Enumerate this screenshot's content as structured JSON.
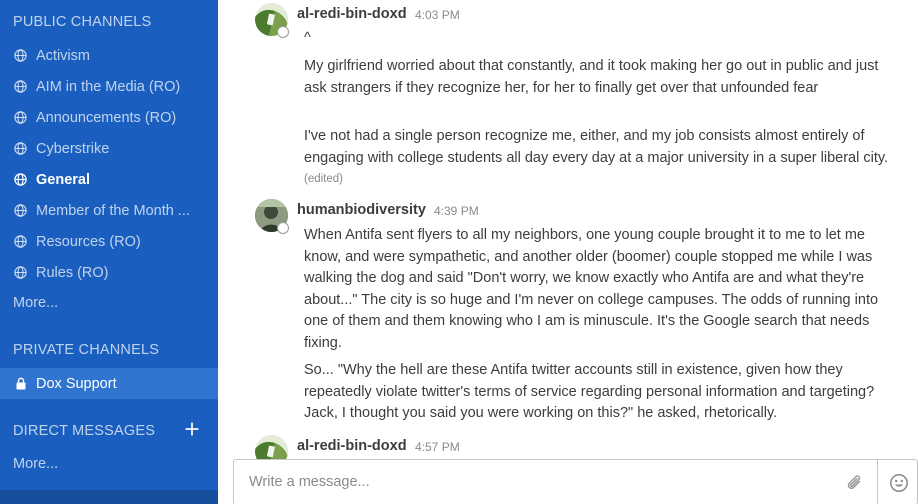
{
  "sidebar": {
    "public_header": "PUBLIC CHANNELS",
    "public_channels": [
      {
        "label": "Activism",
        "icon": "globe-icon"
      },
      {
        "label": "AIM in the Media (RO)",
        "icon": "globe-icon"
      },
      {
        "label": "Announcements (RO)",
        "icon": "globe-icon"
      },
      {
        "label": "Cyberstrike",
        "icon": "globe-icon"
      },
      {
        "label": "General",
        "icon": "globe-icon"
      },
      {
        "label": "Member of the Month ...",
        "icon": "globe-icon"
      },
      {
        "label": "Resources (RO)",
        "icon": "globe-icon"
      },
      {
        "label": "Rules (RO)",
        "icon": "globe-icon"
      }
    ],
    "public_more": "More...",
    "private_header": "PRIVATE CHANNELS",
    "private_channels": [
      {
        "label": "Dox Support",
        "icon": "lock-icon"
      }
    ],
    "direct_header": "DIRECT MESSAGES",
    "direct_more": "More...",
    "colors": {
      "background": "#1a5fbf",
      "selected": "#2f74cf"
    }
  },
  "messages": [
    {
      "author": "al-redi-bin-doxd",
      "time": "4:03 PM",
      "paragraphs": [
        "^",
        "My girlfriend worried about that constantly, and it took making her go out in public and just ask strangers if they recognize her, for her to finally get over that unfounded fear",
        "I've not had a single person recognize me, either, and my job consists almost entirely of engaging with college students all day every day at a major university in a super liberal city."
      ],
      "edited": "(edited)"
    },
    {
      "author": "humanbiodiversity",
      "time": "4:39 PM",
      "paragraphs": [
        "When Antifa sent flyers to all my neighbors, one young couple brought it to me to let me know, and were sympathetic, and another older (boomer) couple stopped me while I was walking the dog and said \"Don't worry, we know exactly who Antifa are and what they're about...\" The city is so huge and I'm never on college campuses. The odds of running into one of them and them knowing who I am is minuscule. It's the Google search that needs fixing.",
        "So... \"Why the hell are these Antifa twitter accounts still in existence, given how they repeatedly violate twitter's terms of service regarding personal information and targeting? Jack, I thought you said you were working on this?\" he asked, rhetorically."
      ]
    },
    {
      "author": "al-redi-bin-doxd",
      "time": "4:57 PM",
      "paragraphs": []
    }
  ],
  "composer": {
    "placeholder": "Write a message...",
    "attach_icon": "paperclip-icon",
    "emoji_icon": "emoji-icon"
  }
}
